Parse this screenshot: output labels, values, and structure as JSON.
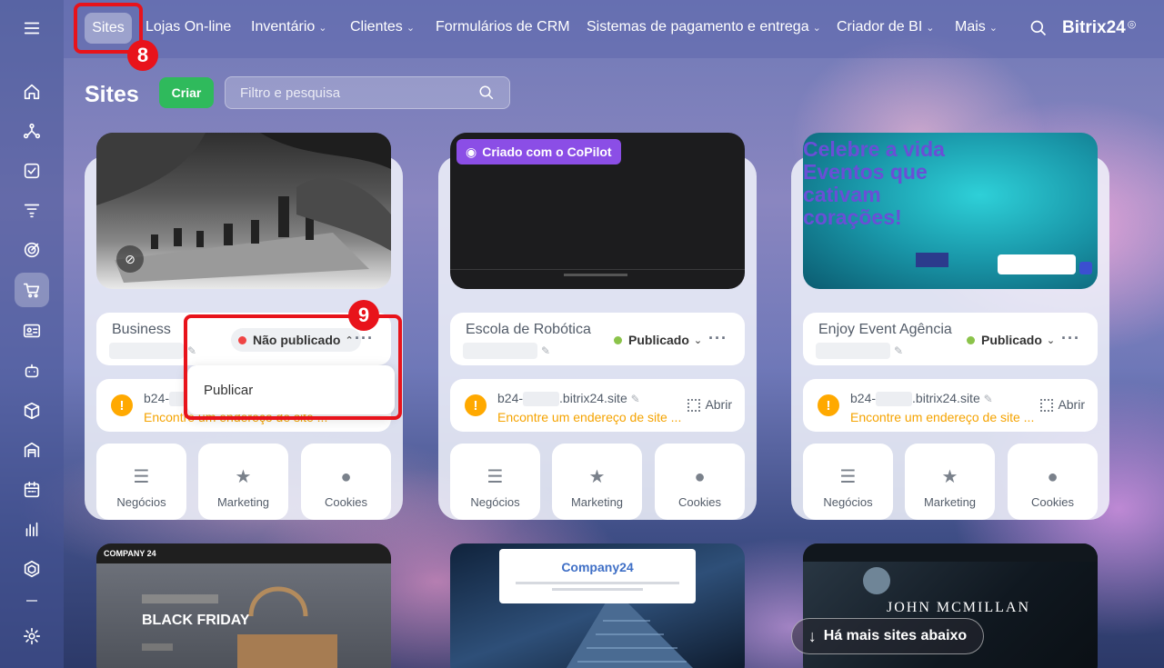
{
  "nav": {
    "sites": "Sites",
    "items": [
      {
        "label": "Lojas On-line",
        "chev": ""
      },
      {
        "label": "Inventário",
        "chev": "⌄"
      },
      {
        "label": "Clientes",
        "chev": "⌄"
      },
      {
        "label": "Formulários de CRM",
        "chev": ""
      },
      {
        "label": "Sistemas de pagamento e entrega",
        "chev": "⌄"
      },
      {
        "label": "Criador de BI",
        "chev": "⌄"
      },
      {
        "label": "Mais",
        "chev": "⌄"
      }
    ],
    "brand": "Bitrix24",
    "brand_mark": "◎"
  },
  "annotations": {
    "a8": "8",
    "a9": "9"
  },
  "page": {
    "title": "Sites",
    "create_label": "Criar",
    "filter_placeholder": "Filtro e pesquisa"
  },
  "cards": [
    {
      "name": "Business",
      "status": "Não publicado",
      "status_color": "#ef4444",
      "domain_prefix": "b24-",
      "domain_suffix": "",
      "warning": "Encontre um endereço de site ...",
      "open": ""
    },
    {
      "name": "Escola de Robótica",
      "status": "Publicado",
      "status_color": "#8bc34a",
      "domain_prefix": "b24-",
      "domain_suffix": ".bitrix24.site",
      "warning": "Encontre um endereço de site ...",
      "open": "Abrir",
      "badge": "Criado com o CoPilot"
    },
    {
      "name": "Enjoy Event Agência",
      "status": "Publicado",
      "status_color": "#8bc34a",
      "domain_prefix": "b24-",
      "domain_suffix": ".bitrix24.site",
      "warning": "Encontre um endereço de site ...",
      "open": "Abrir",
      "hero_text": "Celebre a vida Eventos que cativam corações!"
    }
  ],
  "tiles": [
    "Negócios",
    "Marketing",
    "Cookies"
  ],
  "dropdown": {
    "publish": "Publicar"
  },
  "bottom": {
    "company24_a": "COMPANY 24",
    "black_friday": "BLACK FRIDAY",
    "company24_b": "Company24",
    "john": "JOHN MCMILLAN"
  },
  "more_sites": "Há mais sites abaixo",
  "colors": {
    "accent_green": "#2fba5c",
    "annotation_red": "#e8131b",
    "warning_orange": "#ffa900",
    "copilot_purple": "#8b4ee6"
  }
}
